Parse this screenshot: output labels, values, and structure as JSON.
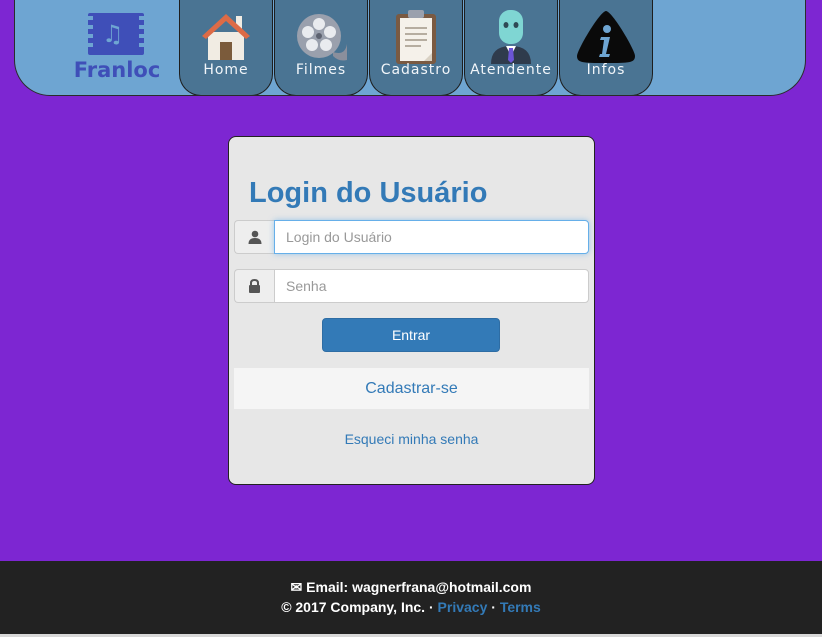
{
  "brand": {
    "name": "Franloc",
    "logo_icon": "music-film-icon"
  },
  "nav": {
    "tabs": [
      {
        "label": "Home",
        "icon": "house-icon"
      },
      {
        "label": "Filmes",
        "icon": "film-reel-icon"
      },
      {
        "label": "Cadastro",
        "icon": "clipboard-icon"
      },
      {
        "label": "Atendente",
        "icon": "attendant-icon"
      },
      {
        "label": "Infos",
        "icon": "info-icon"
      }
    ]
  },
  "login": {
    "title": "Login do Usuário",
    "username": {
      "placeholder": "Login do Usuário",
      "value": "",
      "icon": "user-icon"
    },
    "password": {
      "placeholder": "Senha",
      "value": "",
      "icon": "lock-icon"
    },
    "submit_label": "Entrar",
    "register_label": "Cadastrar-se",
    "forgot_label": "Esqueci minha senha"
  },
  "footer": {
    "email_icon": "envelope-icon",
    "email_text": "Email: wagnerfrana@hotmail.com",
    "copyright": "© 2017 Company, Inc.",
    "separator": "·",
    "privacy_label": "Privacy",
    "terms_label": "Terms"
  },
  "colors": {
    "background": "#7d26d2",
    "navbar": "#6ea5d2",
    "tab": "#4a7493",
    "accent": "#337ab7",
    "brand": "#3f4fb8",
    "footer": "#222222"
  }
}
